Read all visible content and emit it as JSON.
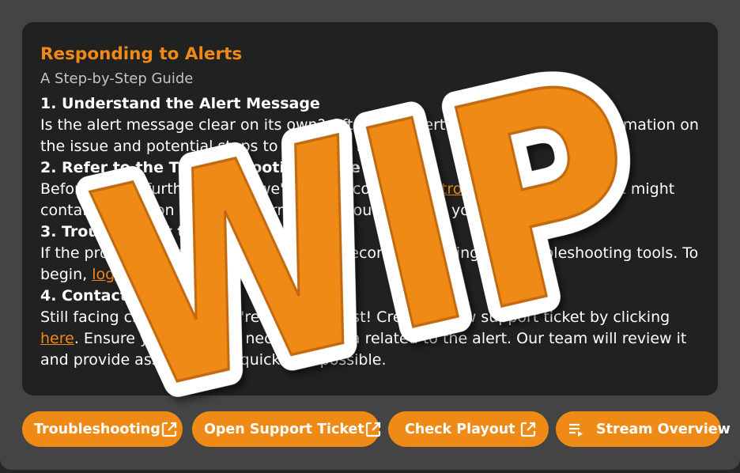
{
  "card": {
    "title": "Responding to Alerts",
    "subtitle": "A Step-by-Step Guide",
    "steps": [
      {
        "title": "1. Understand the Alert Message",
        "text": "Is the alert message clear on its own? Often, the alert will provide direct information on the issue and potential steps to deal with it."
      },
      {
        "title": "2. Refer to the Troubleshooting Guide",
        "text_before": "Before taking further action, we'd ideally consult the ",
        "link": "troubleshooting guide",
        "text_after": ". It might contain a solution or more information about the alert you received."
      },
      {
        "title": "3. Troubleshoot the Alert",
        "text_before": "If the problem persists or isn't clear, we recommend using our troubleshooting tools. To begin, ",
        "link": "log in to the metrics dashboard",
        "text_after": "."
      },
      {
        "title": "4. Contact Support",
        "text_before": "Still facing challenges? We're here to assist! Create a new support ticket by clicking ",
        "link": "here",
        "text_after": ". Ensure you copy any necessary data related to the alert. Our team will review it and provide assistance as quickly as possible."
      }
    ]
  },
  "buttons": [
    {
      "label": "Troubleshooting",
      "icon": "external-link-icon"
    },
    {
      "label": "Open Support Ticket",
      "icon": "external-link-icon"
    },
    {
      "label": "Check Playout",
      "icon": "external-link-icon"
    },
    {
      "label": "Stream Overview",
      "icon": "playlist-play-icon"
    }
  ],
  "overlay": {
    "text": "WIP"
  },
  "colors": {
    "accent": "#ef8a17",
    "card_bg": "#212121",
    "frame_bg": "#444444"
  }
}
